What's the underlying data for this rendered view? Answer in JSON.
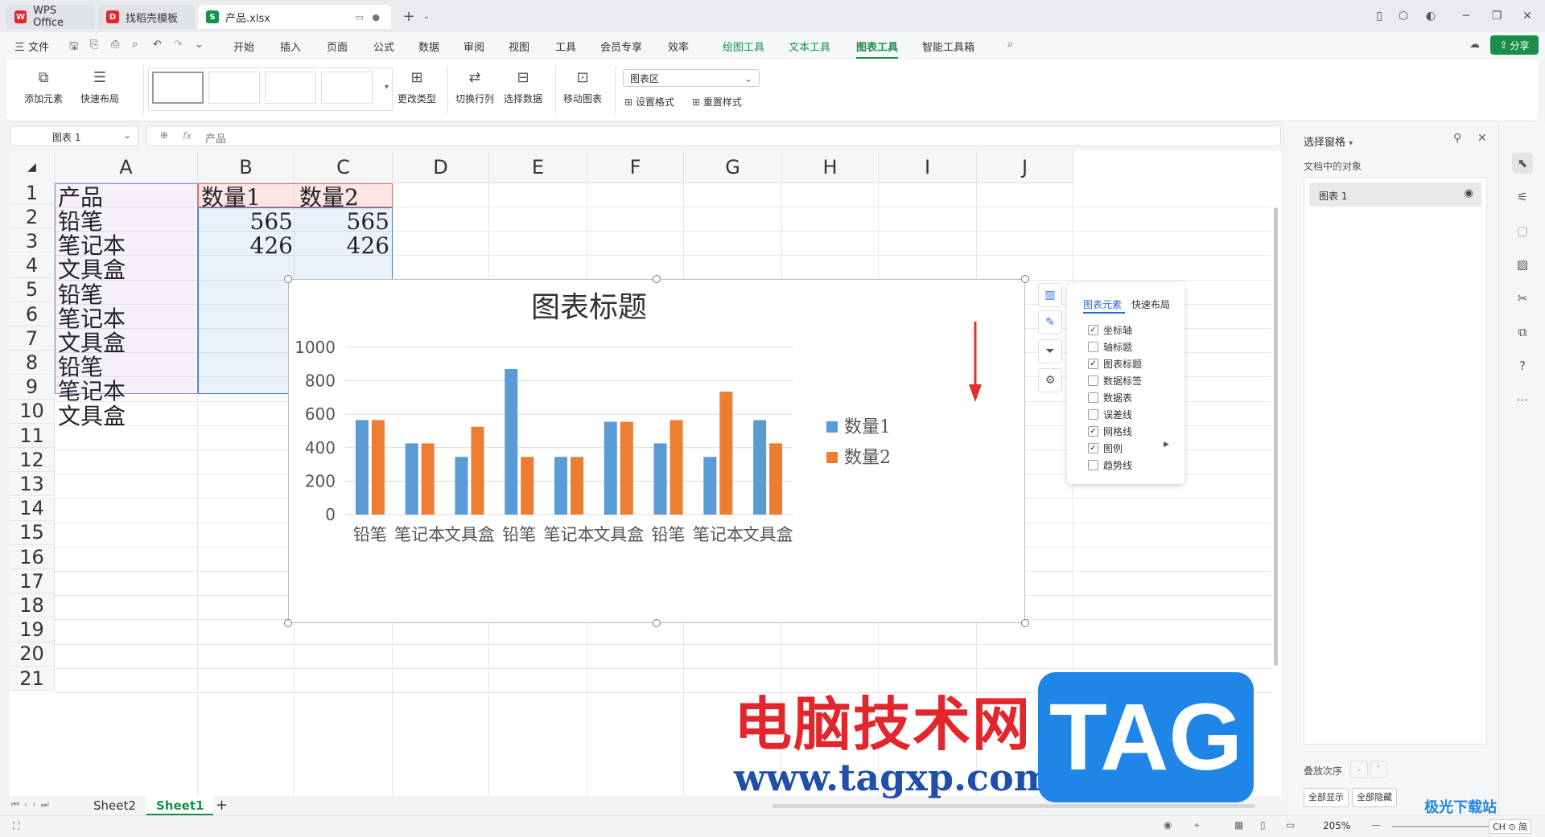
{
  "titlebar": {
    "tabs": [
      {
        "label": "WPS Office",
        "logo": "W",
        "color": "#e2262b"
      },
      {
        "label": "找稻壳模板",
        "logo": "D",
        "color": "#e2262b"
      },
      {
        "label": "产品.xlsx",
        "logo": "S",
        "color": "#1a8f4a"
      }
    ]
  },
  "menubar": {
    "file": "三 文件",
    "items": [
      "开始",
      "插入",
      "页面",
      "公式",
      "数据",
      "审阅",
      "视图",
      "工具",
      "会员专享",
      "效率",
      "绘图工具",
      "文本工具",
      "图表工具",
      "智能工具箱"
    ],
    "active": "图表工具",
    "share": "分享"
  },
  "ribbon": {
    "add_element": "添加元素",
    "quick_layout": "快速布局",
    "change_type": "更改类型",
    "switch_rowcol": "切换行列",
    "select_data": "选择数据",
    "move_chart": "移动图表",
    "chart_area_select": "图表区",
    "set_format": "设置格式",
    "reset_style": "重置样式"
  },
  "formula": {
    "name_box": "图表 1",
    "fx": "fx",
    "content": "产品"
  },
  "grid": {
    "columns": [
      "A",
      "B",
      "C",
      "D",
      "E",
      "F",
      "G",
      "H",
      "I",
      "J"
    ],
    "rows": [
      "1",
      "2",
      "3",
      "4",
      "5",
      "6",
      "7",
      "8",
      "9",
      "10",
      "11",
      "12",
      "13",
      "14",
      "15",
      "16",
      "17",
      "18",
      "19",
      "20",
      "21"
    ],
    "header_row": [
      "产品",
      "数量1",
      "数量2"
    ],
    "col_a": [
      "铅笔",
      "笔记本",
      "文具盒",
      "铅笔",
      "笔记本",
      "文具盒",
      "铅笔",
      "笔记本",
      "文具盒"
    ],
    "b_values": [
      "565",
      "426"
    ],
    "c_values": [
      "565",
      "426"
    ]
  },
  "chart_data": {
    "type": "bar",
    "title": "图表标题",
    "categories": [
      "铅笔",
      "笔记本",
      "文具盒",
      "铅笔",
      "笔记本",
      "文具盒",
      "铅笔",
      "笔记本",
      "文具盒"
    ],
    "series": [
      {
        "name": "数量1",
        "values": [
          565,
          426,
          345,
          870,
          345,
          555,
          426,
          345,
          565
        ],
        "color": "#5b9bd5"
      },
      {
        "name": "数量2",
        "values": [
          565,
          426,
          525,
          345,
          345,
          555,
          565,
          735,
          426
        ],
        "color": "#ed7d31"
      }
    ],
    "yticks": [
      "0",
      "200",
      "400",
      "600",
      "800",
      "1000"
    ],
    "ylim": [
      0,
      1000
    ],
    "grid": true,
    "legend": "right"
  },
  "element_popup": {
    "tab_elements": "图表元素",
    "tab_layout": "快速布局",
    "items": [
      {
        "label": "坐标轴",
        "checked": true
      },
      {
        "label": "轴标题",
        "checked": false
      },
      {
        "label": "图表标题",
        "checked": true
      },
      {
        "label": "数据标签",
        "checked": false
      },
      {
        "label": "数据表",
        "checked": false
      },
      {
        "label": "误差线",
        "checked": false
      },
      {
        "label": "网格线",
        "checked": true
      },
      {
        "label": "图例",
        "checked": true
      },
      {
        "label": "趋势线",
        "checked": false
      }
    ]
  },
  "pane": {
    "title": "选择窗格",
    "section": "文档中的对象",
    "object": "图表 1",
    "stack_order": "叠放次序",
    "show_all": "全部显示",
    "hide_all": "全部隐藏"
  },
  "sheets": {
    "tabs": [
      "Sheet2",
      "Sheet1"
    ],
    "active": "Sheet1",
    "add": "+"
  },
  "status": {
    "zoom": "205%",
    "ime": "CH ⊙ 简"
  },
  "watermark": {
    "cn": "电脑技术网",
    "url": "www.tagxp.com",
    "tag": "TAG",
    "site": "极光下载站"
  }
}
